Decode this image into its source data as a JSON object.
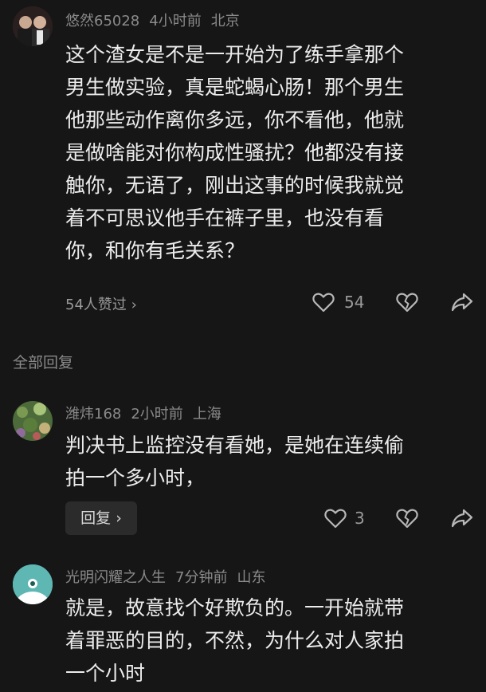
{
  "main_comment": {
    "username": "悠然65028",
    "time": "4小时前",
    "location": "北京",
    "text_lines": [
      "这个渣女是不是一开始为了练手拿那个",
      "男生做实验，真是蛇蝎心肠！那个男生",
      "他那些动作离你多远，你不看他，他就",
      "是做啥能对你构成性骚扰？他都没有接",
      "触你，无语了，刚出这事的时候我就觉",
      "着不可思议他手在裤子里，也没有看",
      "你，和你有毛关系？"
    ],
    "likes_link": "54人赞过 ›",
    "like_count": "54"
  },
  "section_title": "全部回复",
  "replies": [
    {
      "username": "潍炜168",
      "time": "2小时前",
      "location": "上海",
      "text_lines": [
        "判决书上监控没有看她，是她在连续偷",
        "拍一个多小时，"
      ],
      "reply_button": "回复 ›",
      "like_count": "3"
    },
    {
      "username": "光明闪耀之人生",
      "time": "7分钟前",
      "location": "山东",
      "text_lines": [
        "就是，故意找个好欺负的。一开始就带",
        "着罪恶的目的，不然，为什么对人家拍",
        "一个小时"
      ]
    }
  ],
  "icons": {
    "like": "heart-outline-icon",
    "dislike": "broken-heart-icon",
    "share": "share-arrow-icon"
  },
  "colors": {
    "background": "#161616",
    "text": "#ececec",
    "meta": "#8a8a8a",
    "reply_button_bg": "#2b2b2b",
    "avatar_teal": "#5fb7b4"
  }
}
